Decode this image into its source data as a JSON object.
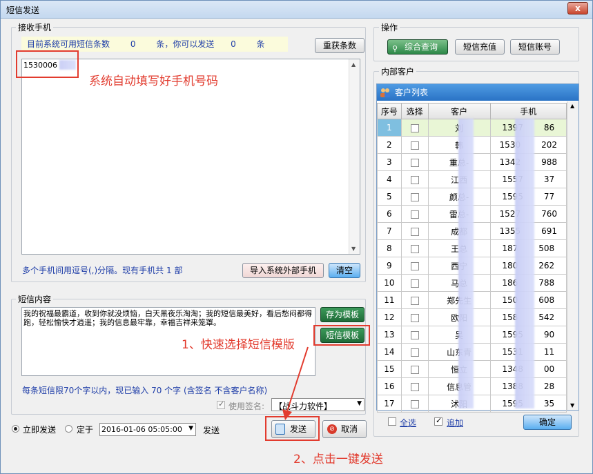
{
  "window": {
    "title": "短信发送",
    "close": "x"
  },
  "receive": {
    "legend": "接收手机",
    "info_prefix": "目前系统可用短信条数",
    "count1": "0",
    "info_mid": "条，你可以发送",
    "count2": "0",
    "info_suffix": "条",
    "refresh_button": "重获条数",
    "phone_value": "1530006",
    "hint": "多个手机间用逗号(,)分隔。现有手机共 1 部",
    "import_button": "导入系统外部手机",
    "clear_button": "清空"
  },
  "content": {
    "legend": "短信内容",
    "message": "我的祝福最霸道，收到你就没烦恼，白天黑夜乐淘淘；我的短信最美好，看后愁闷都得跑，轻松愉快才逍遥；我的信息最牢靠，幸福吉祥来笼罩。",
    "save_template_button": "存为模板",
    "template_button": "短信模板",
    "limit_text": "每条短信限70个字以内，现已输入 70 个字 (含签名 不含客户名称)",
    "use_signature_label": "使用签名:",
    "signature_value": "【战斗力软件】"
  },
  "send": {
    "now_label": "立即发送",
    "timed_label": "定于",
    "datetime": "2016-01-06 05:05:00",
    "send_suffix": "发送",
    "send_button": "发送",
    "cancel_button": "取消"
  },
  "ops": {
    "legend": "操作",
    "query_button": "综合查询",
    "recharge_button": "短信充值",
    "account_button": "短信账号"
  },
  "customers": {
    "legend": "内部客户",
    "list_title": "客户列表",
    "headers": [
      "序号",
      "选择",
      "客户",
      "手机"
    ],
    "rows": [
      {
        "no": "1",
        "name": "刘",
        "phone_a": "1397",
        "phone_b": "86"
      },
      {
        "no": "2",
        "name": "韩",
        "phone_a": "1530",
        "phone_b": "202"
      },
      {
        "no": "3",
        "name": "重总-",
        "phone_a": "1342",
        "phone_b": "988"
      },
      {
        "no": "4",
        "name": "江西",
        "phone_a": "1557",
        "phone_b": "37"
      },
      {
        "no": "5",
        "name": "颜总-",
        "phone_a": "1595",
        "phone_b": "77"
      },
      {
        "no": "6",
        "name": "雷总-",
        "phone_a": "1527",
        "phone_b": "760"
      },
      {
        "no": "7",
        "name": "成都",
        "phone_a": "1355",
        "phone_b": "691"
      },
      {
        "no": "8",
        "name": "王总",
        "phone_a": "187",
        "phone_b": "508"
      },
      {
        "no": "9",
        "name": "西宁",
        "phone_a": "180",
        "phone_b": "262"
      },
      {
        "no": "10",
        "name": "马总",
        "phone_a": "186",
        "phone_b": "788"
      },
      {
        "no": "11",
        "name": "郑先生",
        "phone_a": "150",
        "phone_b": "608"
      },
      {
        "no": "12",
        "name": "欧阳",
        "phone_a": "158",
        "phone_b": "542"
      },
      {
        "no": "13",
        "name": "吴",
        "phone_a": "1595",
        "phone_b": "90"
      },
      {
        "no": "14",
        "name": "山东青",
        "phone_a": "1531",
        "phone_b": "11"
      },
      {
        "no": "15",
        "name": "恒立",
        "phone_a": "1348",
        "phone_b": "00"
      },
      {
        "no": "16",
        "name": "信息管",
        "phone_a": "1388",
        "phone_b": "28"
      },
      {
        "no": "17",
        "name": "沭阳",
        "phone_a": "1595",
        "phone_b": "35"
      }
    ],
    "select_all_label": "全选",
    "append_label": "追加",
    "confirm_button": "确定"
  },
  "annotations": {
    "phone_note": "系统自动填写好手机号码",
    "template_note": "1、快速选择短信模版",
    "send_note": "2、点击一键发送"
  }
}
